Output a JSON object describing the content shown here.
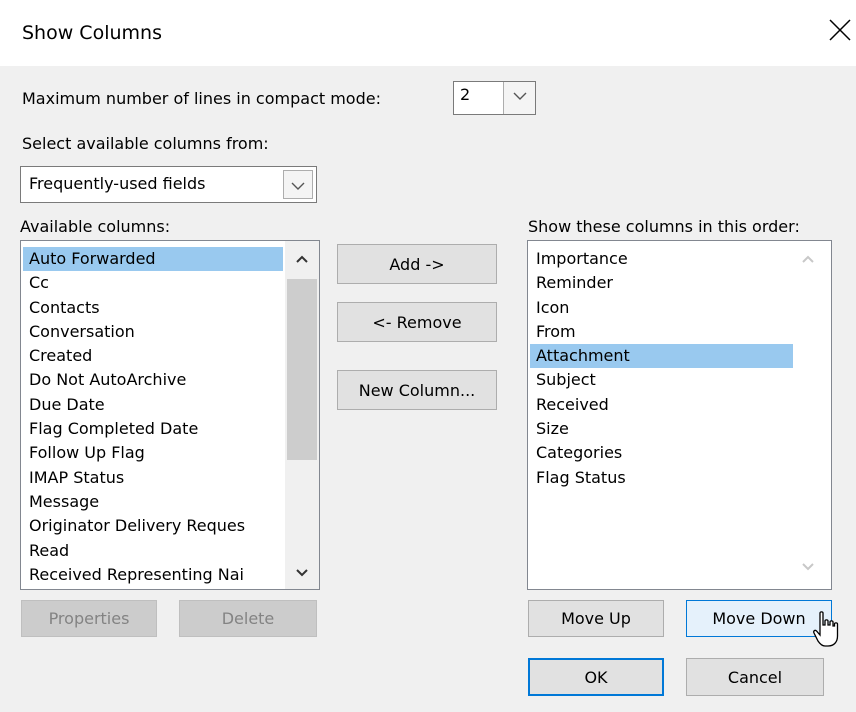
{
  "dialog": {
    "title": "Show Columns",
    "close_icon": "close-icon"
  },
  "compact_mode": {
    "label": "Maximum number of lines in compact mode:",
    "value": "2"
  },
  "source": {
    "label": "Select available columns from:",
    "selected": "Frequently-used fields"
  },
  "available": {
    "label": "Available columns:",
    "items": [
      "Auto Forwarded",
      "Cc",
      "Contacts",
      "Conversation",
      "Created",
      "Do Not AutoArchive",
      "Due Date",
      "Flag Completed Date",
      "Follow Up Flag",
      "IMAP Status",
      "Message",
      "Originator Delivery Reques",
      "Read",
      "Received Representing Nai"
    ],
    "selected": "Auto Forwarded"
  },
  "shown": {
    "label": "Show these columns in this order:",
    "items": [
      "Importance",
      "Reminder",
      "Icon",
      "From",
      "Attachment",
      "Subject",
      "Received",
      "Size",
      "Categories",
      "Flag Status"
    ],
    "selected": "Attachment"
  },
  "buttons": {
    "add": "Add ->",
    "remove": "<- Remove",
    "new_column": "New Column...",
    "properties": "Properties",
    "delete": "Delete",
    "move_up": "Move Up",
    "move_down": "Move Down",
    "ok": "OK",
    "cancel": "Cancel"
  },
  "colors": {
    "selection": "#99c9ef",
    "accent": "#0078d7",
    "background": "#f0f0f0"
  }
}
